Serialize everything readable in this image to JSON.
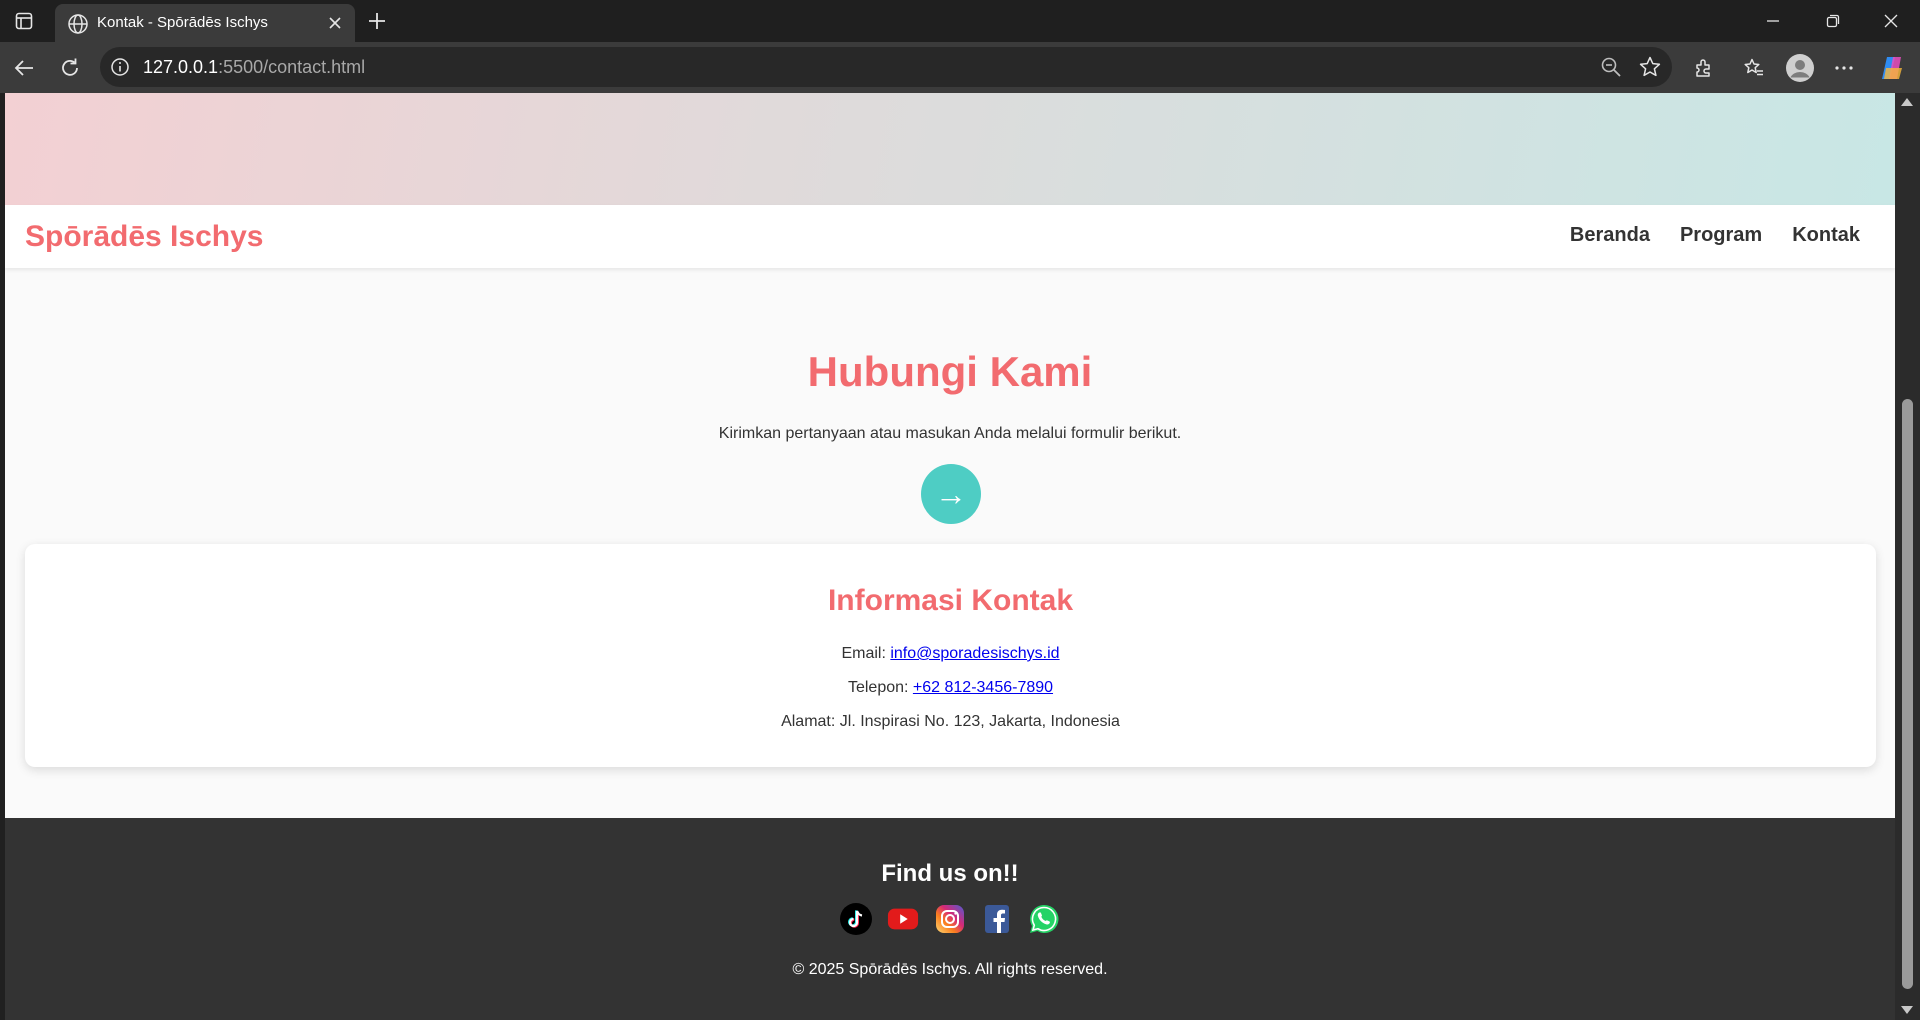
{
  "browser": {
    "tab_title": "Kontak - Spōrādēs Ischys",
    "url_host": "127.0.0.1",
    "url_rest": ":5500/contact.html"
  },
  "site": {
    "brand": "Spōrādēs Ischys",
    "nav": [
      {
        "label": "Beranda"
      },
      {
        "label": "Program"
      },
      {
        "label": "Kontak"
      }
    ]
  },
  "hero": {
    "title": "Hubungi Kami",
    "subtitle": "Kirimkan pertanyaan atau masukan Anda melalui formulir berikut.",
    "arrow": "→"
  },
  "contact": {
    "title": "Informasi Kontak",
    "email_label": "Email: ",
    "email": "info@sporadesischys.id",
    "phone_label": "Telepon: ",
    "phone": "+62 812-3456-7890",
    "address": "Alamat: Jl. Inspirasi No. 123, Jakarta, Indonesia"
  },
  "footer": {
    "title": "Find us on!!",
    "socials": [
      "tiktok-icon",
      "youtube-icon",
      "instagram-icon",
      "facebook-icon",
      "whatsapp-icon"
    ],
    "copyright": "© 2025 Spōrādēs Ischys. All rights reserved."
  },
  "colors": {
    "brand": "#f26b6f",
    "accent": "#4ecdc4",
    "footer_bg": "#333333"
  }
}
